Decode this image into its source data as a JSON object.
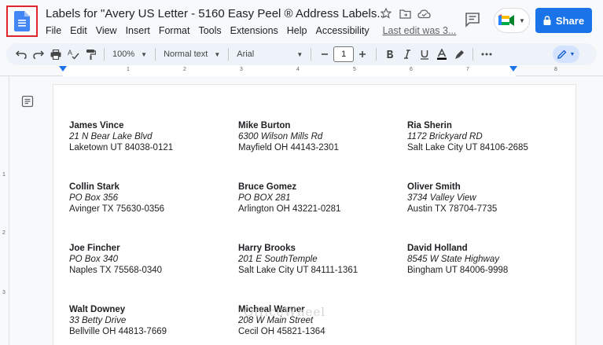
{
  "header": {
    "title": "Labels for \"Avery US Letter - 5160 Easy Peel ® Address Labels...",
    "menu": [
      "File",
      "Edit",
      "View",
      "Insert",
      "Format",
      "Tools",
      "Extensions",
      "Help",
      "Accessibility"
    ],
    "last_edit": "Last edit was 3...",
    "share_label": "Share"
  },
  "toolbar": {
    "zoom": "100%",
    "style": "Normal text",
    "font": "Arial",
    "font_size": "1"
  },
  "ruler": {
    "numbers": [
      "1",
      "2",
      "3",
      "4",
      "5",
      "6",
      "7",
      "8"
    ]
  },
  "vruler": {
    "numbers": [
      "1",
      "2",
      "3"
    ]
  },
  "labels": [
    {
      "name": "James Vince",
      "street": "21 N Bear Lake Blvd",
      "city": "Laketown UT 84038-0121"
    },
    {
      "name": "Mike Burton",
      "street": "6300 Wilson Mills Rd",
      "city": "Mayfield OH 44143-2301"
    },
    {
      "name": "Ria Sherin",
      "street": "1172 Brickyard RD",
      "city": "Salt Lake City UT  84106-2685"
    },
    {
      "name": "Collin Stark",
      "street": "PO Box 356",
      "city": "Avinger TX 75630-0356"
    },
    {
      "name": "Bruce Gomez",
      "street": "PO BOX 281",
      "city": "Arlington OH 43221-0281"
    },
    {
      "name": "Oliver Smith",
      "street": "3734 Valley View",
      "city": "Austin TX 78704-7735"
    },
    {
      "name": "Joe Fincher",
      "street": "PO Box 340",
      "city": "Naples TX 75568-0340"
    },
    {
      "name": "Harry Brooks",
      "street": "201 E SouthTemple",
      "city": "Salt Lake City UT 84111-1361"
    },
    {
      "name": "David Holland",
      "street": "8545 W State Highway",
      "city": "Bingham UT 84006-9998"
    },
    {
      "name": "Walt Downey",
      "street": "33 Betty Drive",
      "city": "Bellville OH 44813-7669"
    },
    {
      "name": "Micheal Warner",
      "street": "208 W Main Street",
      "city": "Cecil OH 45821-1364"
    }
  ],
  "watermark": "OfficeWheel",
  "colors": {
    "accent": "#1a73e8",
    "highlight_box": "#e0242b"
  }
}
